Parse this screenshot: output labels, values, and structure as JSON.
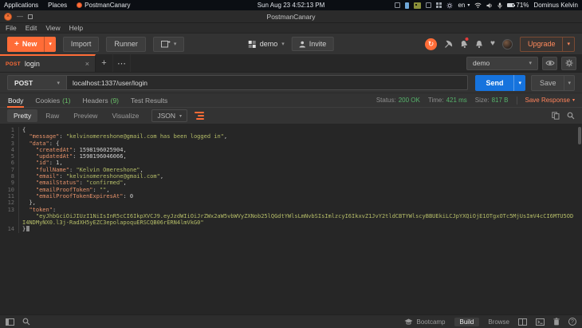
{
  "colors": {
    "accent": "#ff6c37",
    "send_blue": "#1673dd",
    "status_green": "#56b36b"
  },
  "icons": {
    "close": "×",
    "plus": "+",
    "more": "⋯",
    "caret": "▾",
    "sync": "↻",
    "heart": "♥"
  },
  "system_bar": {
    "applications": "Applications",
    "places": "Places",
    "app_name": "PostmanCanary",
    "clock": "Sun Aug 23   4:52:13 PM",
    "language": "en",
    "battery": "71%",
    "user": "Dominus Kelvin"
  },
  "titlebar": {
    "title": "PostmanCanary"
  },
  "menubar": {
    "items": [
      "File",
      "Edit",
      "View",
      "Help"
    ]
  },
  "toolbar": {
    "new_label": "New",
    "import_label": "Import",
    "runner_label": "Runner",
    "workspace": "demo",
    "invite_label": "Invite",
    "upgrade_label": "Upgrade"
  },
  "tabbar": {
    "tab_method": "POST",
    "tab_title": "login",
    "environment": "demo"
  },
  "request": {
    "method": "POST",
    "url": "localhost:1337/user/login",
    "send_label": "Send",
    "save_label": "Save"
  },
  "response": {
    "tab_body": "Body",
    "tab_cookies": "Cookies",
    "cookies_count": "(1)",
    "tab_headers": "Headers",
    "headers_count": "(9)",
    "tab_tests": "Test Results",
    "status_label": "Status:",
    "status_value": "200 OK",
    "time_label": "Time:",
    "time_value": "421 ms",
    "size_label": "Size:",
    "size_value": "817 B",
    "save_response_label": "Save Response",
    "view_pretty": "Pretty",
    "view_raw": "Raw",
    "view_preview": "Preview",
    "view_visualize": "Visualize",
    "format": "JSON"
  },
  "code": {
    "lines": [
      {
        "n": "1",
        "seg": [
          {
            "t": "p",
            "v": "{"
          }
        ]
      },
      {
        "n": "2",
        "seg": [
          {
            "t": "p",
            "v": "  "
          },
          {
            "t": "k",
            "v": "\"message\""
          },
          {
            "t": "p",
            "v": ": "
          },
          {
            "t": "s",
            "v": "\"kelvinomereshone@gmail.com has been logged in\""
          },
          {
            "t": "p",
            "v": ","
          }
        ]
      },
      {
        "n": "3",
        "seg": [
          {
            "t": "p",
            "v": "  "
          },
          {
            "t": "k",
            "v": "\"data\""
          },
          {
            "t": "p",
            "v": ": {"
          }
        ]
      },
      {
        "n": "4",
        "seg": [
          {
            "t": "p",
            "v": "    "
          },
          {
            "t": "k",
            "v": "\"createdAt\""
          },
          {
            "t": "p",
            "v": ": "
          },
          {
            "t": "n2",
            "v": "1598196025904"
          },
          {
            "t": "p",
            "v": ","
          }
        ]
      },
      {
        "n": "5",
        "seg": [
          {
            "t": "p",
            "v": "    "
          },
          {
            "t": "k",
            "v": "\"updatedAt\""
          },
          {
            "t": "p",
            "v": ": "
          },
          {
            "t": "n2",
            "v": "1598196046066"
          },
          {
            "t": "p",
            "v": ","
          }
        ]
      },
      {
        "n": "6",
        "seg": [
          {
            "t": "p",
            "v": "    "
          },
          {
            "t": "k",
            "v": "\"id\""
          },
          {
            "t": "p",
            "v": ": "
          },
          {
            "t": "n2",
            "v": "1"
          },
          {
            "t": "p",
            "v": ","
          }
        ]
      },
      {
        "n": "7",
        "seg": [
          {
            "t": "p",
            "v": "    "
          },
          {
            "t": "k",
            "v": "\"fullName\""
          },
          {
            "t": "p",
            "v": ": "
          },
          {
            "t": "s",
            "v": "\"Kelvin Omereshone\""
          },
          {
            "t": "p",
            "v": ","
          }
        ]
      },
      {
        "n": "8",
        "seg": [
          {
            "t": "p",
            "v": "    "
          },
          {
            "t": "k",
            "v": "\"email\""
          },
          {
            "t": "p",
            "v": ": "
          },
          {
            "t": "s",
            "v": "\"kelvinomereshone@gmail.com\""
          },
          {
            "t": "p",
            "v": ","
          }
        ]
      },
      {
        "n": "9",
        "seg": [
          {
            "t": "p",
            "v": "    "
          },
          {
            "t": "k",
            "v": "\"emailStatus\""
          },
          {
            "t": "p",
            "v": ": "
          },
          {
            "t": "s",
            "v": "\"confirmed\""
          },
          {
            "t": "p",
            "v": ","
          }
        ]
      },
      {
        "n": "10",
        "seg": [
          {
            "t": "p",
            "v": "    "
          },
          {
            "t": "k",
            "v": "\"emailProofToken\""
          },
          {
            "t": "p",
            "v": ": "
          },
          {
            "t": "s",
            "v": "\"\""
          },
          {
            "t": "p",
            "v": ","
          }
        ]
      },
      {
        "n": "11",
        "seg": [
          {
            "t": "p",
            "v": "    "
          },
          {
            "t": "k",
            "v": "\"emailProofTokenExpiresAt\""
          },
          {
            "t": "p",
            "v": ": "
          },
          {
            "t": "n2",
            "v": "0"
          }
        ]
      },
      {
        "n": "12",
        "seg": [
          {
            "t": "p",
            "v": "  },"
          }
        ]
      },
      {
        "n": "13",
        "seg": [
          {
            "t": "p",
            "v": "  "
          },
          {
            "t": "k",
            "v": "\"token\""
          },
          {
            "t": "p",
            "v": ":"
          }
        ]
      },
      {
        "n": "",
        "seg": [
          {
            "t": "p",
            "v": "    "
          },
          {
            "t": "s",
            "v": "\"eyJhbGciOiJIUzI1NiIsInR5cCI6IkpXVCJ9.eyJzdWIiOiJrZWx2aW5vbWVyZXNob25lQGdtYWlsLmNvbSIsImlzcyI6IkxvZ1JvY2tldCBTYWlscyBBUEkiLCJpYXQiOjE1OTgxOTc5MjUsImV4cCI6MTU5ODI4NDMyNX0.l3j-RadXH5yEZC3epolapoquERSCQB06rERN4lmVkG0\""
          }
        ]
      },
      {
        "n": "14",
        "seg": [
          {
            "t": "p",
            "v": "}"
          }
        ],
        "cursor": true
      }
    ]
  },
  "statusbar": {
    "bootcamp": "Bootcamp",
    "build": "Build",
    "browse": "Browse",
    "help": "?"
  }
}
